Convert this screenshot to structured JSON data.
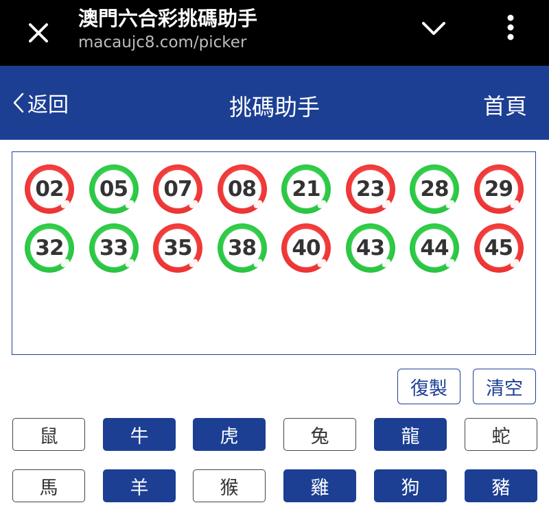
{
  "browser": {
    "title": "澳門六合彩挑碼助手",
    "url": "macaujc8.com/picker",
    "icons": {
      "close": "close-icon",
      "collapse": "chevron-down-icon",
      "more": "more-vertical-icon"
    }
  },
  "header": {
    "back_label": "返回",
    "title": "挑碼助手",
    "home_label": "首頁",
    "bg_color": "#1c3f94"
  },
  "balls": [
    {
      "num": "02",
      "color": "red"
    },
    {
      "num": "05",
      "color": "green"
    },
    {
      "num": "07",
      "color": "red"
    },
    {
      "num": "08",
      "color": "red"
    },
    {
      "num": "21",
      "color": "green"
    },
    {
      "num": "23",
      "color": "red"
    },
    {
      "num": "28",
      "color": "green"
    },
    {
      "num": "29",
      "color": "red"
    },
    {
      "num": "32",
      "color": "green"
    },
    {
      "num": "33",
      "color": "green"
    },
    {
      "num": "35",
      "color": "red"
    },
    {
      "num": "38",
      "color": "green"
    },
    {
      "num": "40",
      "color": "red"
    },
    {
      "num": "43",
      "color": "green"
    },
    {
      "num": "44",
      "color": "green"
    },
    {
      "num": "45",
      "color": "red"
    }
  ],
  "ball_colors": {
    "red": "#f23b3b",
    "green": "#2fcc47"
  },
  "actions": {
    "copy_label": "復製",
    "clear_label": "清空"
  },
  "zodiac": [
    {
      "label": "鼠",
      "selected": false
    },
    {
      "label": "牛",
      "selected": true
    },
    {
      "label": "虎",
      "selected": true
    },
    {
      "label": "兔",
      "selected": false
    },
    {
      "label": "龍",
      "selected": true
    },
    {
      "label": "蛇",
      "selected": false
    },
    {
      "label": "馬",
      "selected": false
    },
    {
      "label": "羊",
      "selected": true
    },
    {
      "label": "猴",
      "selected": false
    },
    {
      "label": "雞",
      "selected": true
    },
    {
      "label": "狗",
      "selected": true
    },
    {
      "label": "豬",
      "selected": true
    }
  ]
}
